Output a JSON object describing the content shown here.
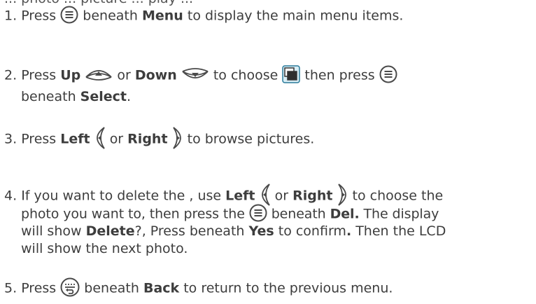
{
  "intro": "... photo ... picture ... play ...",
  "steps": [
    {
      "num": "1.",
      "t1": "Press",
      "t2": "beneath",
      "b1": "Menu",
      "t3": "to display the main menu items."
    },
    {
      "num": "2.",
      "t1": "Press",
      "b1": "Up",
      "t2": "or",
      "b2": "Down",
      "t3": "to choose",
      "t4": "then press",
      "t5": "beneath",
      "b3": "Select",
      "t6": "."
    },
    {
      "num": "3.",
      "t1": "Press",
      "b1": "Left",
      "t2": "or",
      "b2": "Right",
      "t3": "to browse pictures."
    },
    {
      "num": "4.",
      "t1": "If you want to delete the , use",
      "b1": "Left",
      "t2": "or",
      "b2": "Right",
      "t3": "to choose the",
      "t4": "photo you want to, then press the",
      "t5": "beneath",
      "b3": "Del.",
      "t6": "The display",
      "t7": "will show",
      "b4": "Delete",
      "t8": "?, Press beneath",
      "b5": "Yes",
      "t9": "to confirm",
      "b6": ".",
      "t10": "Then the LCD",
      "t11": "will show the next photo."
    },
    {
      "num": "5.",
      "t1": "Press",
      "t2": "beneath",
      "b1": "Back",
      "t3": "to return to the previous menu."
    }
  ],
  "icons": {
    "menu_button": "menu-button-icon",
    "up_arrow": "up-arrow-icon",
    "down_arrow": "down-arrow-icon",
    "left_arrow": "left-arrow-icon",
    "right_arrow": "right-arrow-icon",
    "slideshow": "photo-frame-icon",
    "back_button": "back-button-icon"
  },
  "colors": {
    "text": "#3d3d3d",
    "icon_stroke": "#4a4a4a",
    "frame_icon": "#2a7a9a"
  }
}
